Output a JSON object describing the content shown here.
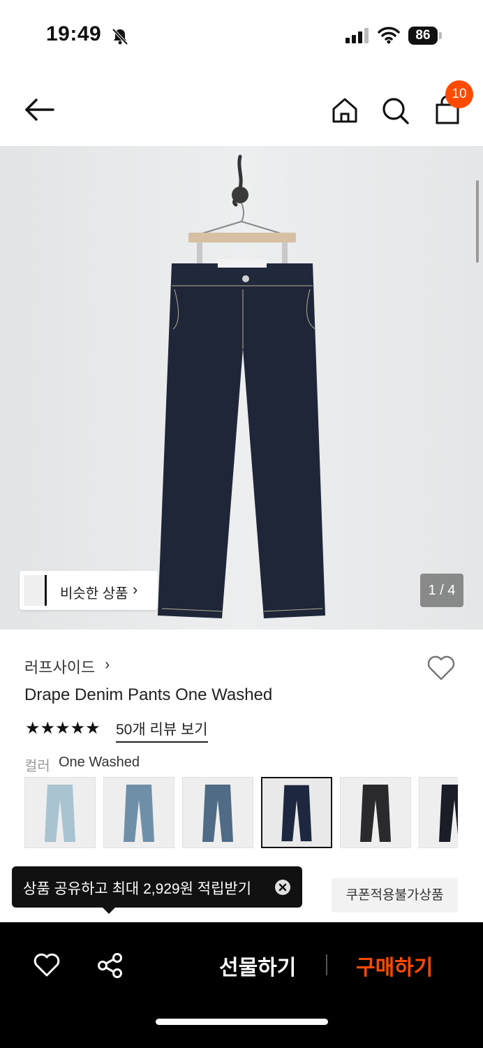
{
  "status_bar": {
    "time": "19:49",
    "battery": "86"
  },
  "header": {
    "cart_count": "10"
  },
  "gallery": {
    "similar_label": "비슷한 상품",
    "counter": "1 / 4"
  },
  "product": {
    "brand": "러프사이드",
    "title": "Drape Denim Pants One Washed",
    "stars": "★★★★★",
    "review_link": "50개 리뷰 보기",
    "color_key": "컬러",
    "color_value": "One Washed",
    "swatches": [
      {
        "color": "#a9c3d0"
      },
      {
        "color": "#6f8fa9"
      },
      {
        "color": "#4f6b86"
      },
      {
        "color": "#1e2740"
      },
      {
        "color": "#2a2a2c"
      },
      {
        "color": "#1b1e26"
      }
    ],
    "selected_swatch_index": 3
  },
  "tooltip": {
    "text": "상품 공유하고 최대 2,929원 적립받기"
  },
  "coupon_tag": "쿠폰적용불가상품",
  "bottom_bar": {
    "gift_label": "선물하기",
    "buy_label": "구매하기"
  },
  "colors": {
    "accent": "#ff4a00",
    "denim": "#1f2638"
  }
}
